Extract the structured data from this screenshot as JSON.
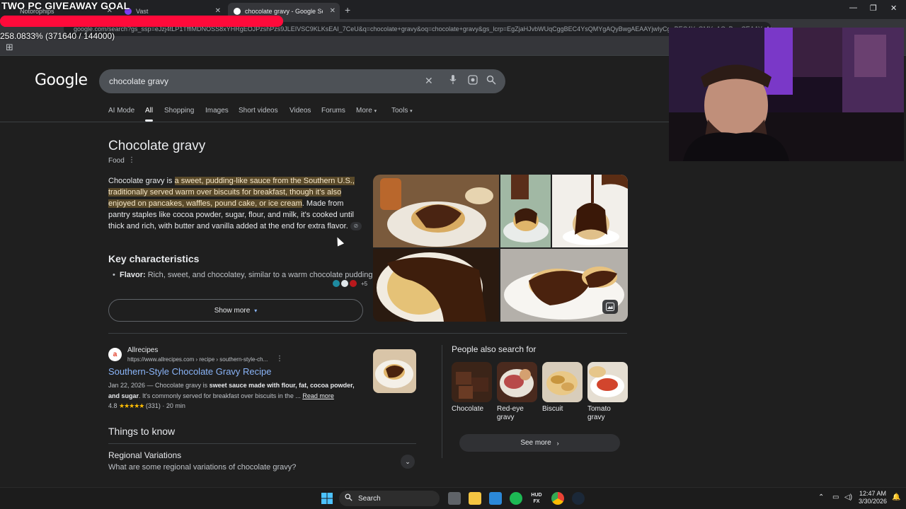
{
  "overlay": {
    "goal_title": "TWO PC GIVEAWAY GOAL",
    "progress_text": "258.0833% (371640 / 144000)",
    "progress_fraction": 1.0
  },
  "browser": {
    "tabs": [
      {
        "label": "Notorophips",
        "active": false
      },
      {
        "label": "Vast",
        "active": false
      },
      {
        "label": "chocolate gravy - Google Search",
        "active": true
      }
    ],
    "url": "google.com/search?gs_ssp=eJzj4tLP1TfflMDNOSS8xYHRgEOJPzshPzs9JLEIVSC9KLKsEAI_7CeU&q=chocolate+gravy&oq=chocolate+gravy&gs_lcrp=EgZjaHJvbWUqCggBEC4YsQMYgAQyBwgAEAAYjwIyCggBEC4YsQMYgAQyBwgCEAAYgAQ"
  },
  "google": {
    "logo": "Google",
    "query": "chocolate gravy",
    "nav_tabs": [
      "AI Mode",
      "All",
      "Shopping",
      "Images",
      "Short videos",
      "Videos",
      "Forums",
      "More",
      "Tools"
    ],
    "active_tab": "All"
  },
  "knowledge_panel": {
    "title": "Chocolate gravy",
    "subtitle": "Food",
    "desc_lead": "Chocolate gravy is ",
    "desc_highlight": "a sweet, pudding-like sauce from the Southern U.S., traditionally served warm over biscuits for breakfast, though it's also enjoyed on pancakes, waffles, pound cake, or ice cream",
    "desc_rest": ". Made from pantry staples like cocoa powder, sugar, flour, and milk, it's cooked until thick and rich, with butter and vanilla added at the end for extra flavor.",
    "key_title": "Key characteristics",
    "bullet_label": "Flavor:",
    "bullet_text": " Rich, sweet, and chocolatey, similar to a warm chocolate pudding.",
    "sources_more": "+5",
    "show_more": "Show more"
  },
  "result": {
    "site": "Allrecipes",
    "url": "https://www.allrecipes.com › recipe › southern-style-ch...",
    "title": "Southern-Style Chocolate Gravy Recipe",
    "snippet_date": "Jan 22, 2026 — Chocolate gravy is ",
    "snippet_bold": "sweet sauce made with flour, fat, cocoa powder, and sugar",
    "snippet_rest": ". It's commonly served for breakfast over biscuits in the ... ",
    "read_more": "Read more",
    "rating": "4.8",
    "stars": "★★★★★",
    "rating_meta": "(331) · 20 min"
  },
  "things_to_know": {
    "title": "Things to know",
    "question": "Regional Variations",
    "answer": "What are some regional variations of chocolate gravy?"
  },
  "people_also_search": {
    "title": "People also search for",
    "items": [
      {
        "label": "Chocolate"
      },
      {
        "label": "Red-eye gravy"
      },
      {
        "label": "Biscuit"
      },
      {
        "label": "Tomato gravy"
      }
    ],
    "see_more": "See more"
  },
  "taskbar": {
    "search": "Search",
    "time": "12:47 AM",
    "date": "3/30/2026"
  },
  "colors": {
    "link": "#8ab4f8",
    "highlight_bg": "#5a4a2a",
    "star": "#fbbc04",
    "goal_bar": "#ff1a4b"
  }
}
